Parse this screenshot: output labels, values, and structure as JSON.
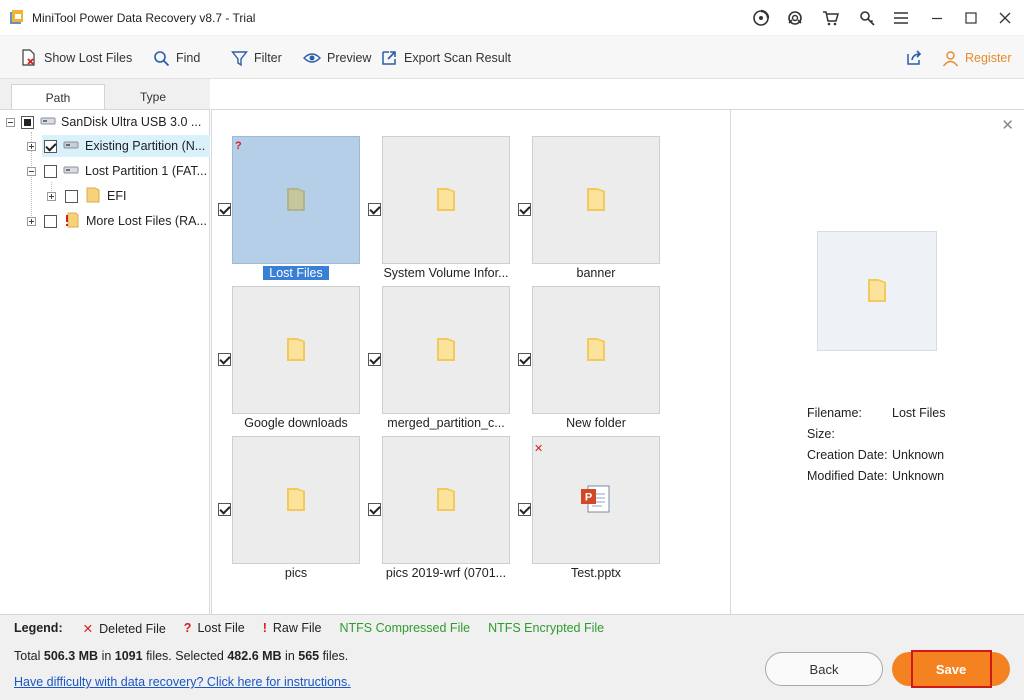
{
  "window": {
    "title": "MiniTool Power Data Recovery v8.7 - Trial"
  },
  "toolbar": {
    "show_lost_files": "Show Lost Files",
    "find": "Find",
    "filter": "Filter",
    "preview": "Preview",
    "export": "Export Scan Result",
    "register": "Register"
  },
  "tabs": {
    "path": "Path",
    "type": "Type"
  },
  "tree": {
    "root": "SanDisk Ultra USB 3.0 ...",
    "items": [
      {
        "label": "Existing Partition (N..."
      },
      {
        "label": "Lost Partition 1 (FAT..."
      },
      {
        "label": "EFI"
      },
      {
        "label": "More Lost Files (RA..."
      }
    ]
  },
  "files": [
    {
      "name": "Lost Files"
    },
    {
      "name": "System Volume Infor..."
    },
    {
      "name": "banner"
    },
    {
      "name": "Google downloads"
    },
    {
      "name": "merged_partition_c..."
    },
    {
      "name": "New folder"
    },
    {
      "name": "pics"
    },
    {
      "name": "pics 2019-wrf (0701..."
    },
    {
      "name": "Test.pptx"
    }
  ],
  "preview": {
    "filename_label": "Filename:",
    "filename_value": "Lost Files",
    "size_label": "Size:",
    "created_label": "Creation Date:",
    "created_value": "Unknown",
    "modified_label": "Modified Date:",
    "modified_value": "Unknown"
  },
  "legend": {
    "label": "Legend:",
    "deleted": "Deleted File",
    "lost": "Lost File",
    "raw": "Raw File",
    "compressed": "NTFS Compressed File",
    "encrypted": "NTFS Encrypted File"
  },
  "totals": {
    "t1": "Total ",
    "total_size": "506.3 MB",
    "t2": " in ",
    "total_files": "1091",
    "t3": " files.  Selected ",
    "selected_size": "482.6 MB",
    "t4": " in ",
    "selected_files": "565",
    "t5": " files."
  },
  "help_link": "Have difficulty with data recovery? Click here for instructions.",
  "buttons": {
    "back": "Back",
    "save": "Save"
  },
  "colors": {
    "accent": "#f58220",
    "selection": "#b6cfe9",
    "link": "#1a56c8",
    "green": "#2f9b2f",
    "red": "#d42020"
  }
}
